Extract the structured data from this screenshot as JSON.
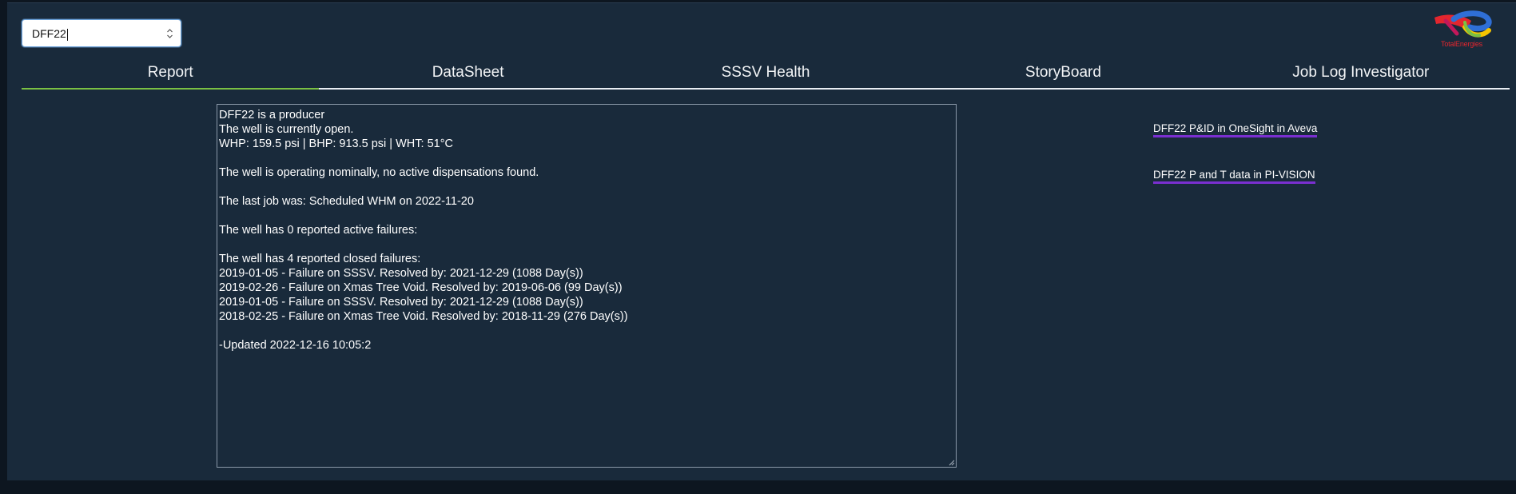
{
  "well_selector": {
    "value": "DFF22"
  },
  "brand": {
    "name": "TotalEnergies",
    "colors": {
      "red": "#e3262e",
      "blue": "#2f6fd6",
      "yellow": "#f6c400",
      "green": "#7ac043"
    }
  },
  "tabs": [
    {
      "label": "Report",
      "active": true
    },
    {
      "label": "DataSheet",
      "active": false
    },
    {
      "label": "SSSV Health",
      "active": false
    },
    {
      "label": "StoryBoard",
      "active": false
    },
    {
      "label": "Job Log Investigator",
      "active": false
    }
  ],
  "report": {
    "lines": [
      "DFF22 is a producer",
      "The well is currently open.",
      "WHP: 159.5 psi | BHP: 913.5 psi | WHT: 51°C",
      "",
      "The well is operating nominally, no active dispensations found.",
      "",
      "The last job was: Scheduled WHM on 2022-11-20",
      "",
      "The well has 0 reported active failures:",
      "",
      "The well has 4 reported closed failures:",
      "2019-01-05 - Failure on SSSV. Resolved by: 2021-12-29 (1088 Day(s))",
      "2019-02-26 - Failure on Xmas Tree Void. Resolved by: 2019-06-06 (99 Day(s))",
      "2019-01-05 - Failure on SSSV. Resolved by: 2021-12-29 (1088 Day(s))",
      "2018-02-25 - Failure on Xmas Tree Void. Resolved by: 2018-11-29 (276 Day(s))",
      "",
      "-Updated 2022-12-16 10:05:2"
    ]
  },
  "links": [
    {
      "label": "DFF22 P&ID in OneSight in Aveva"
    },
    {
      "label": "DFF22 P and T data in PI-VISION"
    }
  ],
  "colors": {
    "panel_bg": "#192a3b",
    "active_tab_underline": "#7ac043",
    "link_underline": "#7a2fd0"
  }
}
